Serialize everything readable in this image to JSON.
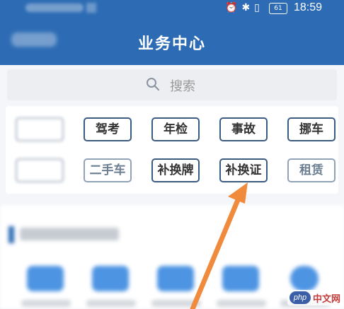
{
  "status_bar": {
    "time": "18:59",
    "battery": "61",
    "icons": [
      "alarm-icon",
      "bluetooth-icon",
      "vibrate-icon"
    ]
  },
  "header": {
    "title": "业务中心"
  },
  "search": {
    "placeholder": "搜索"
  },
  "tags": {
    "row1": [
      "驾考",
      "年检",
      "事故",
      "挪车"
    ],
    "row2": [
      "二手车",
      "补换牌",
      "补换证",
      "租赁"
    ]
  },
  "watermark": {
    "logo": "php",
    "text": "中文网"
  },
  "colors": {
    "header_bg": "#2d6cb4",
    "tag_border": "#3a5c7e",
    "arrow": "#f08a3c"
  }
}
